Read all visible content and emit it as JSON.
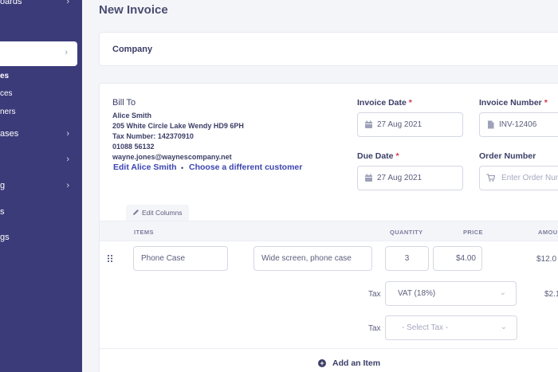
{
  "sidebar": {
    "items": [
      {
        "label": "oards"
      },
      {
        "label": "ases"
      },
      {
        "label": "g"
      },
      {
        "label": "s"
      },
      {
        "label": "gs"
      }
    ],
    "subitems": [
      "es",
      "ces",
      "ners"
    ]
  },
  "page": {
    "title": "New Invoice"
  },
  "company": {
    "label": "Company"
  },
  "bill_to": {
    "heading": "Bill To",
    "name": "Alice Smith",
    "address": "205 White Circle Lake Wendy HD9 6PH",
    "tax_number": "Tax Number: 142370910",
    "phone": "01088 56132",
    "email": "wayne.jones@waynescompany.net",
    "edit_link": "Edit Alice Smith",
    "separator": "•",
    "change_link": "Choose a different customer"
  },
  "fields": {
    "invoice_date": {
      "label": "Invoice Date",
      "required": "*",
      "value": "27 Aug 2021"
    },
    "invoice_number": {
      "label": "Invoice Number",
      "required": "*",
      "value": "INV-12406"
    },
    "due_date": {
      "label": "Due Date",
      "required": "*",
      "value": "27 Aug 2021"
    },
    "order_number": {
      "label": "Order Number",
      "placeholder": "Enter Order Num"
    }
  },
  "table": {
    "edit_columns": "Edit Columns",
    "headers": [
      "ITEMS",
      "QUANTITY",
      "PRICE",
      "AMOUN"
    ],
    "row": {
      "item": "Phone Case",
      "description": "Wide screen, phone case",
      "quantity": "3",
      "price": "$4.00",
      "amount": "$12.0"
    },
    "tax_rows": [
      {
        "label": "Tax",
        "value": "VAT (18%)",
        "amount": "$2.1"
      },
      {
        "label": "Tax",
        "value": "- Select Tax -",
        "amount": ""
      }
    ],
    "add_item": "Add an Item"
  },
  "colors": {
    "sidebar": "#3b3b7a",
    "accent": "#3c44b1",
    "required": "#d63447",
    "background": "#f4f5f9"
  }
}
